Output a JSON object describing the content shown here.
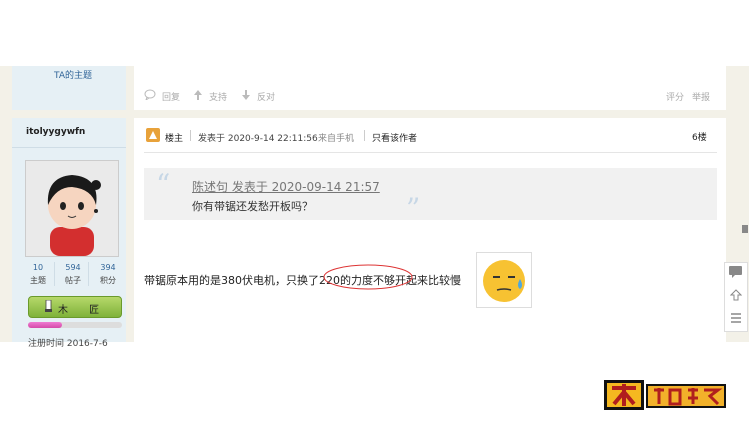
{
  "prev_post": {
    "ta_threads_link": "TA的主题",
    "reply_label": "回复",
    "support_label": "支持",
    "oppose_label": "反对",
    "rate_label": "评分",
    "report_label": "举报"
  },
  "author": {
    "name": "itolyygywfn",
    "stats": [
      {
        "value": "10",
        "label": "主题"
      },
      {
        "value": "594",
        "label": "帖子"
      },
      {
        "value": "394",
        "label": "积分"
      }
    ],
    "rank_label": "木 匠",
    "register_time": "注册时间 2016-7-6",
    "level_progress": 0.36
  },
  "post": {
    "owner_tag": "楼主",
    "post_time": "发表于 2020-9-14 22:11:56",
    "source": "来自手机",
    "only_author": "只看该作者",
    "floor": "6楼",
    "quote_header": "陈述句 发表于 2020-09-14 21:57",
    "quote_text": "你有带锯还发愁开板吗？",
    "body_text": "带锯原本用的是380伏电机，只换了220的力度不够开起来比较慢"
  },
  "site_logo": "木工爱好者",
  "colors": {
    "link": "#336699",
    "accent_orange": "#e8a23a",
    "green_badge": "#7fb23a"
  }
}
